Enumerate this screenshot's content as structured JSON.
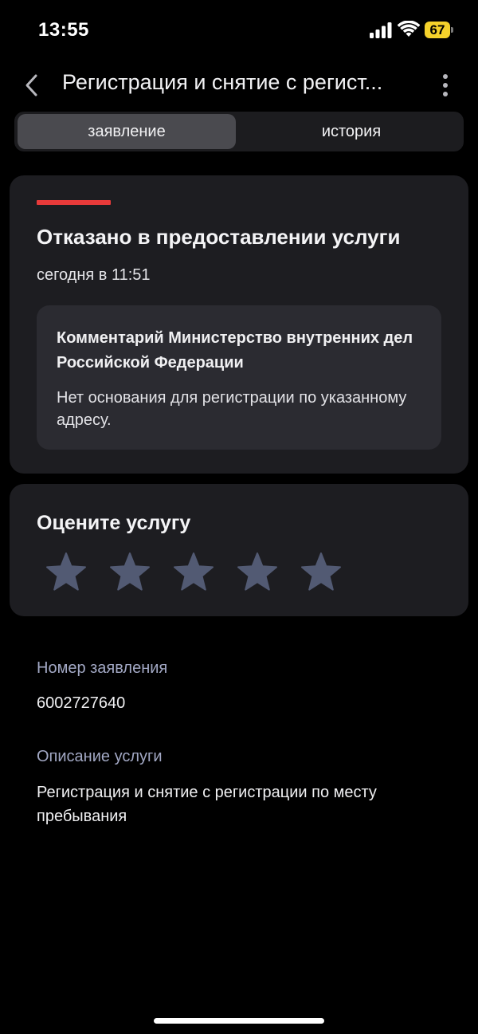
{
  "status_bar": {
    "time": "13:55",
    "battery": "67",
    "battery_color": "#f5d22b"
  },
  "header": {
    "title": "Регистрация и снятие с регист..."
  },
  "tabs": [
    {
      "label": "заявление",
      "active": true
    },
    {
      "label": "история",
      "active": false
    }
  ],
  "status_card": {
    "title": "Отказано в предоставлении услуги",
    "time": "сегодня в 11:51",
    "accent_color": "#e83a3a",
    "comment_title": "Комментарий Министерство внутренних дел Российской Федерации",
    "comment_text": "Нет основания для регистрации по указанному адресу."
  },
  "rating": {
    "title": "Оцените услугу",
    "max_stars": 5,
    "selected": 0
  },
  "details": {
    "number_label": "Номер заявления",
    "number_value": "6002727640",
    "description_label": "Описание услуги",
    "description_value": "Регистрация и снятие с регистрации по месту пребывания"
  },
  "icons": [
    "signal-icon",
    "wifi-icon",
    "battery-icon",
    "back-chevron-icon",
    "more-vertical-icon",
    "star-icon"
  ]
}
